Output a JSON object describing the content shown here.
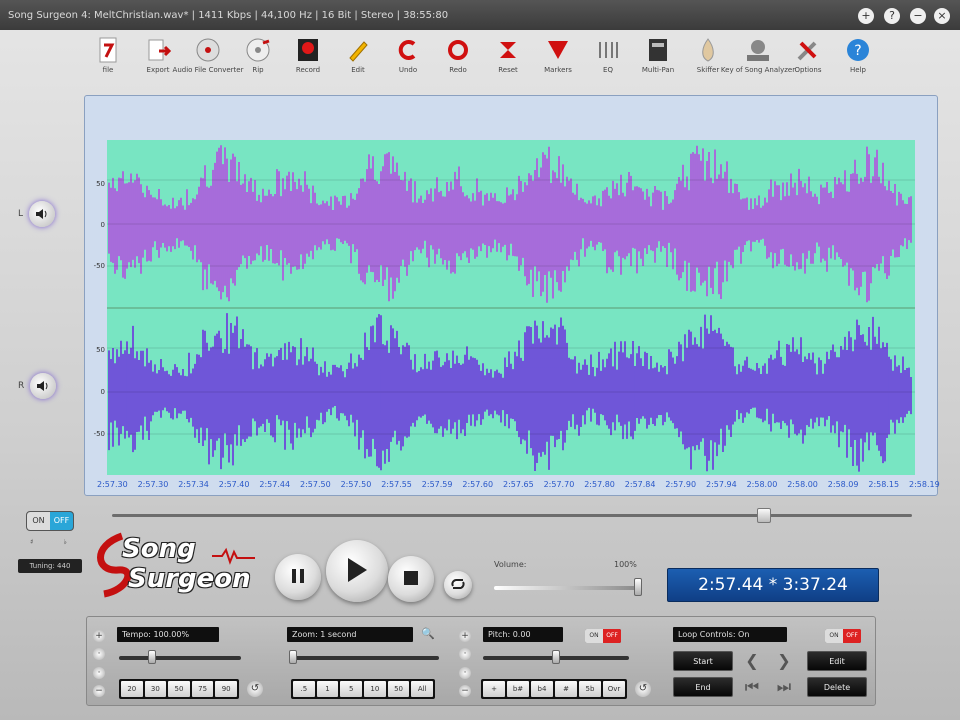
{
  "window": {
    "title": "Song Surgeon 4: MeltChristian.wav* | 1411 Kbps | 44,100 Hz | 16 Bit | Stereo | 38:55:80",
    "buttons": [
      "+",
      "?",
      "−",
      "×"
    ]
  },
  "toolbar": [
    {
      "label": "file",
      "icon": "file-icon"
    },
    {
      "label": "Export",
      "icon": "export-icon"
    },
    {
      "label": "Audio File Converter",
      "icon": "audio-converter-icon"
    },
    {
      "label": "Rip",
      "icon": "rip-cd-icon"
    },
    {
      "label": "Record",
      "icon": "record-icon"
    },
    {
      "label": "Edit",
      "icon": "pencil-icon"
    },
    {
      "label": "Undo",
      "icon": "undo-icon"
    },
    {
      "label": "Redo",
      "icon": "redo-icon"
    },
    {
      "label": "Reset",
      "icon": "reset-icon"
    },
    {
      "label": "Markers",
      "icon": "markers-icon"
    },
    {
      "label": "EQ",
      "icon": "eq-icon"
    },
    {
      "label": "Multi-Pan",
      "icon": "multi-pan-icon"
    },
    {
      "label": "Skiffer",
      "icon": "skiffer-icon"
    },
    {
      "label": "Key of Song Analyzer",
      "icon": "key-analyzer-icon"
    },
    {
      "label": "Options",
      "icon": "options-icon"
    },
    {
      "label": "Help",
      "icon": "help-icon"
    }
  ],
  "channels": {
    "left_label": "L",
    "right_label": "R"
  },
  "wave": {
    "top_ticks": [
      "50",
      "0",
      "-50"
    ],
    "bottom_ticks": [
      "50",
      "0",
      "-50"
    ],
    "time_ticks": [
      "2:57.30",
      "2:57.30",
      "2:57.34",
      "2:57.40",
      "2:57.44",
      "2:57.50",
      "2:57.50",
      "2:57.55",
      "2:57.59",
      "2:57.60",
      "2:57.65",
      "2:57.70",
      "2:57.80",
      "2:57.84",
      "2:57.90",
      "2:57.94",
      "2:58.00",
      "2:58.00",
      "2:58.09",
      "2:58.15",
      "2:58.19"
    ],
    "colors": {
      "background": "#78e5c2",
      "top": "#b34ee0",
      "bottom": "#6d32de"
    }
  },
  "scrollbar_position": 0.82,
  "pitch_toggle": {
    "on": "ON",
    "off": "OFF"
  },
  "pitch_marks": "♯ ♭",
  "tuning": "Tuning: 440",
  "logo": {
    "line1": "Song",
    "line2": "Surgeon"
  },
  "transport": {
    "pause": "pause-icon",
    "play": "play-icon",
    "stop": "stop-icon",
    "loop": "loop-icon"
  },
  "volume": {
    "label": "Volume:",
    "value": "100%",
    "fraction": 1.0
  },
  "time_display": "2:57.44 * 3:37.24",
  "tempo": {
    "value": "Tempo: 100.00%",
    "slider": 0.25,
    "presets": [
      "20",
      "30",
      "50",
      "75",
      "90"
    ]
  },
  "zoom": {
    "value": "Zoom: 1 second",
    "slider": 0.0,
    "presets": [
      ".5",
      "1",
      "5",
      "10",
      "50",
      "All"
    ]
  },
  "pitch": {
    "value": "Pitch: 0.00",
    "slider": 0.5,
    "presets": [
      "+",
      "b#",
      "b4",
      "#",
      "5b",
      "Ovr"
    ],
    "switch": {
      "a": "ON",
      "b": "OFF"
    }
  },
  "loop": {
    "value": "Loop Controls: On",
    "switch": {
      "a": "ON",
      "b": "OFF"
    },
    "start": "Start",
    "end": "End",
    "edit": "Edit",
    "delete": "Delete"
  }
}
